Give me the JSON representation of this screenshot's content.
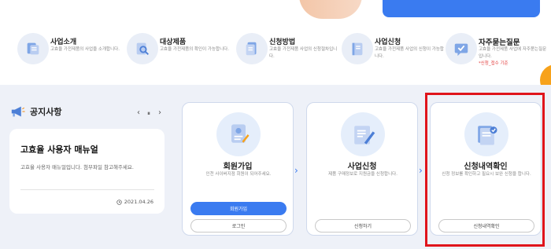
{
  "quick_menu": [
    {
      "title": "사업소개",
      "desc": "고효율 가전제품의 사업을 소개합니다.",
      "note": "",
      "icon": "business-intro-icon"
    },
    {
      "title": "대상제품",
      "desc": "고효율 가전제품의 확인이 가능합니다.",
      "note": "",
      "icon": "product-search-icon"
    },
    {
      "title": "신청방법",
      "desc": "고효율 가전제품 사업의 신청절차입니다.",
      "note": "",
      "icon": "document-icon"
    },
    {
      "title": "사업신청",
      "desc": "고효율 가전제품 사업의 신청이 가능합니다.",
      "note": "",
      "icon": "notebook-icon"
    },
    {
      "title": "자주묻는질문",
      "desc": "고효율 가전제품 사업에 자주묻는질문입니다.",
      "note": "*신청_접수 기준",
      "icon": "faq-icon"
    }
  ],
  "notice": {
    "title": "공지사항",
    "prev": "‹",
    "pause": "⏸",
    "next": "›",
    "card_title": "고효율 사용자 매뉴얼",
    "card_desc": "고효율 사용자 매뉴얼입니다. 첨부파일 참고해주세요.",
    "card_date": "2021.04.26"
  },
  "steps": [
    {
      "title": "회원가입",
      "desc": "인천 사이버지점 회원이 되어주세요.",
      "primary": "회원가입",
      "secondary": "로그인"
    },
    {
      "title": "사업신청",
      "desc": "제품 구매정보로 지원금을 신청합니다.",
      "primary": "",
      "secondary": "신청하기"
    },
    {
      "title": "신청내역확인",
      "desc": "신청 정보를 확인하고 필요시 보완 신청을 합니다.",
      "primary": "",
      "secondary": "신청내역확인"
    }
  ],
  "colors": {
    "accent": "#3a7bf0",
    "highlight": "#e0141b",
    "panel_bg": "#eef1f8"
  }
}
